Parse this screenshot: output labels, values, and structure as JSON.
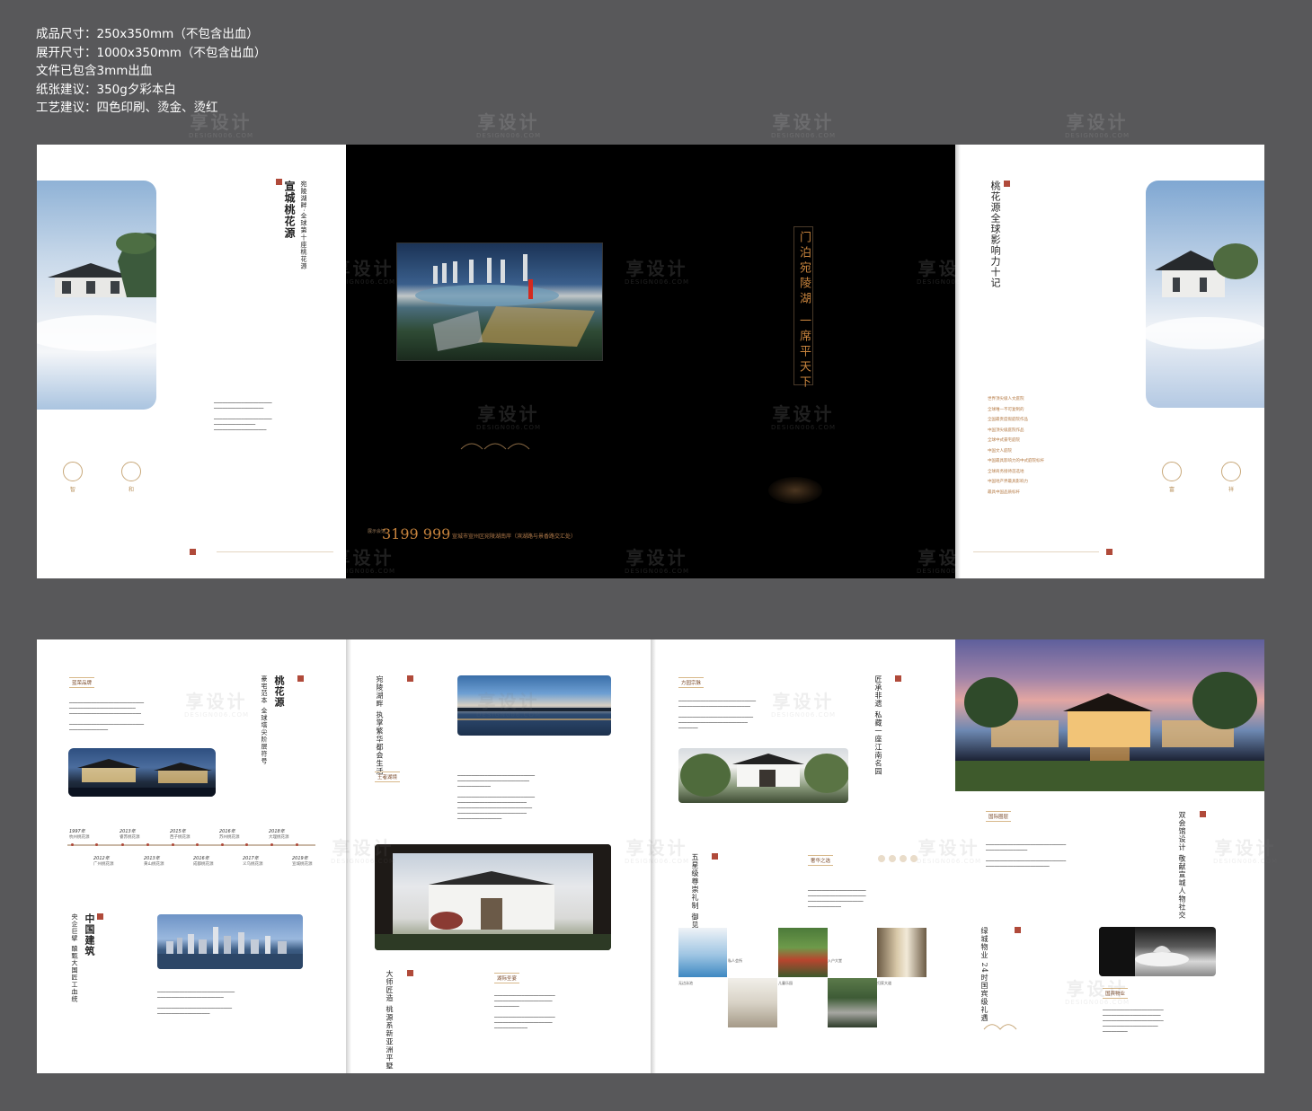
{
  "specs": [
    "成品尺寸：250x350mm（不包含出血）",
    "展开尺寸：1000x350mm（不包含出血）",
    "文件已包含3mm出血",
    "纸张建议：350g夕彩本白",
    "工艺建议：四色印刷、烫金、烫红"
  ],
  "watermark": {
    "text": "享设计",
    "sub": "DESIGN006.COM"
  },
  "top": {
    "p1": {
      "title": "宣城桃花源",
      "subtitle": "宛陵湖畔·全球第十座桃花源",
      "emblems": [
        "智",
        "和"
      ]
    },
    "spread": {
      "slogan": "门泊宛陵湖 一席平天下",
      "phone": "3199 999",
      "phone_prefix": "展示会馆",
      "address": "宣城市宣州区宛陵湖南岸（滨湖路与景香路交汇处）"
    },
    "p4": {
      "title": "桃花源全球影响力十记",
      "emblems": [
        "富",
        "祥"
      ],
      "list": [
        "世界顶尖级人文庭院",
        "全球唯一不可复制的",
        "全国最贵度假庭院作品",
        "中国顶尖级庭院作品",
        "全球中式豪宅庭院",
        "中国文人庭院",
        "中国最具影响力的中式庭院标杆",
        "全球商务接待首选地",
        "中国地产界最具影响力",
        "最具中国品质标杆"
      ]
    }
  },
  "bottom": {
    "p1": {
      "tag1": "蓝荣品牌",
      "title_big": "桃花源",
      "title_small": "豪宅范本 全球塔尖阶层符号",
      "timeline_top": [
        {
          "year": "1997年",
          "label": "杭州桃花源"
        },
        {
          "year": "2013年",
          "label": "睿苏桃花源"
        },
        {
          "year": "2015年",
          "label": "西子桃花源"
        },
        {
          "year": "2016年",
          "label": "苏州桃花源"
        },
        {
          "year": "2018年",
          "label": "大理桃花源"
        }
      ],
      "timeline_bottom": [
        {
          "year": "2012年",
          "label": "广州桃花源"
        },
        {
          "year": "2013年",
          "label": "黄山桃花源"
        },
        {
          "year": "2016年",
          "label": "成都桃花源"
        },
        {
          "year": "2017年",
          "label": "义乌桃花源"
        },
        {
          "year": "2019年",
          "label": "宣城桃花源"
        }
      ],
      "title2_big": "中国建筑",
      "title2_small": "央企巨擘 酿甄大国匠工血统"
    },
    "p2": {
      "title": "宛陵湖畔 执掌繁华都会生活",
      "tag1": "王者湖境",
      "tag2": "湖际圣宴",
      "title2": "大师匠造 桃源系新亚洲平墅"
    },
    "p3": {
      "tag1": "方园宗脉",
      "title": "匠承非遗 私藏一座江南名园",
      "tag2": "奢华之选",
      "title2": "五星级尊崇礼制 御见名流所享",
      "thumb_caps": [
        "私人会所",
        "儿童乐园",
        "入户大堂",
        "无边泳池",
        "归家大道",
        "归家大道"
      ]
    },
    "p4": {
      "tag1": "国际圈层",
      "title": "双会馆设计 敬献宣城人物社交",
      "title2": "绿城物业 24时国宾级礼遇",
      "tag2": "国宾物业"
    }
  }
}
